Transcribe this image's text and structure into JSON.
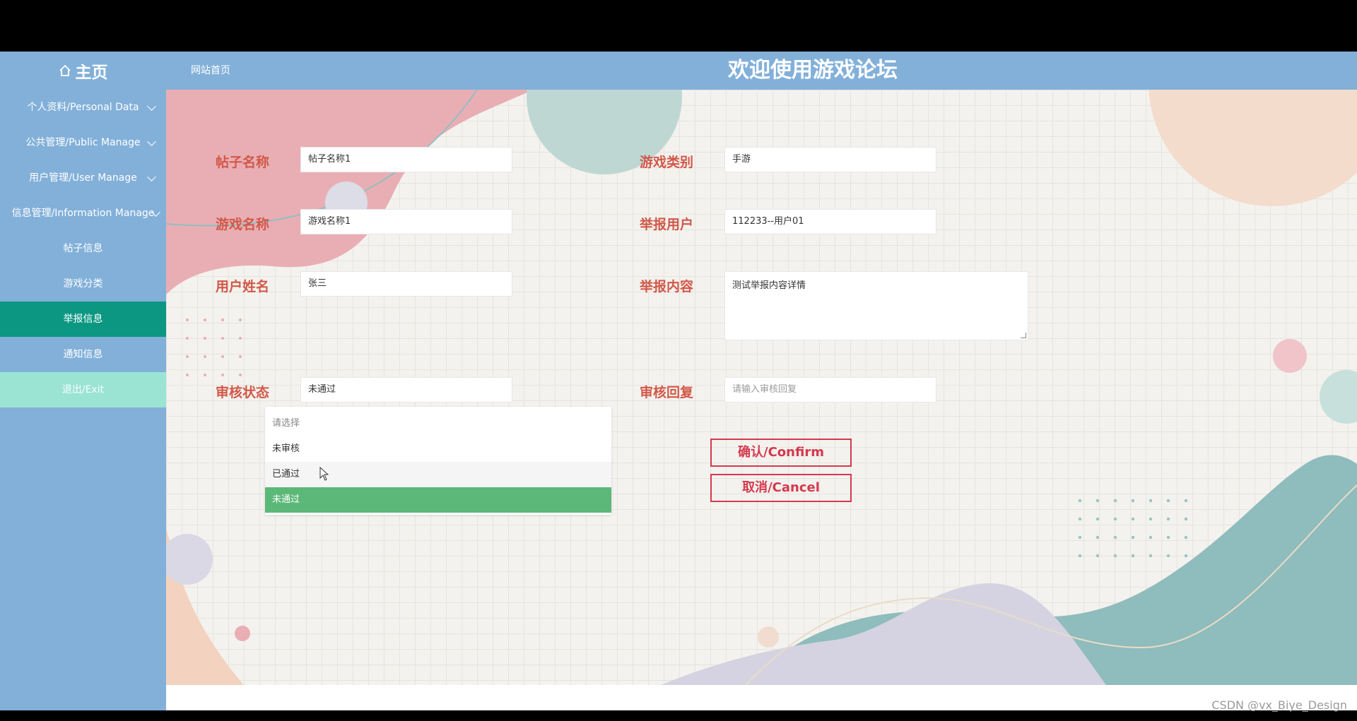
{
  "header": {
    "brand": "主页",
    "breadcrumb": "网站首页",
    "title": "欢迎使用游戏论坛"
  },
  "sidebar": {
    "items": [
      {
        "label": "个人资料/Personal Data",
        "has_arrow": true
      },
      {
        "label": "公共管理/Public Manage",
        "has_arrow": true
      },
      {
        "label": "用户管理/User Manage",
        "has_arrow": true
      },
      {
        "label": "信息管理/Information Manage",
        "has_arrow": true
      },
      {
        "label": "帖子信息"
      },
      {
        "label": "游戏分类"
      },
      {
        "label": "举报信息",
        "active": true
      },
      {
        "label": "通知信息"
      },
      {
        "label": "退出/Exit"
      }
    ]
  },
  "form": {
    "post_name": {
      "label": "帖子名称",
      "value": "帖子名称1"
    },
    "game_category": {
      "label": "游戏类别",
      "value": "手游"
    },
    "game_name": {
      "label": "游戏名称",
      "value": "游戏名称1"
    },
    "report_user": {
      "label": "举报用户",
      "value": "112233--用户01"
    },
    "user_name": {
      "label": "用户姓名",
      "value": "张三"
    },
    "report_content": {
      "label": "举报内容",
      "value": "测试举报内容详情"
    },
    "review_status": {
      "label": "审核状态",
      "value": "未通过"
    },
    "review_reply": {
      "label": "审核回复",
      "placeholder": "请输入审核回复"
    }
  },
  "dropdown": {
    "options": [
      "请选择",
      "未审核",
      "已通过",
      "未通过"
    ],
    "selected": "未通过",
    "hovered": "已通过"
  },
  "buttons": {
    "confirm": "确认/Confirm",
    "cancel": "取消/Cancel"
  },
  "watermark": "CSDN @vx_Biye_Design",
  "colors": {
    "sidebar": "#82b0d9",
    "active": "#0b9782",
    "exit": "#9be3d3",
    "label": "#d15848",
    "button": "#d4394e",
    "selected_option": "#5cb878"
  }
}
